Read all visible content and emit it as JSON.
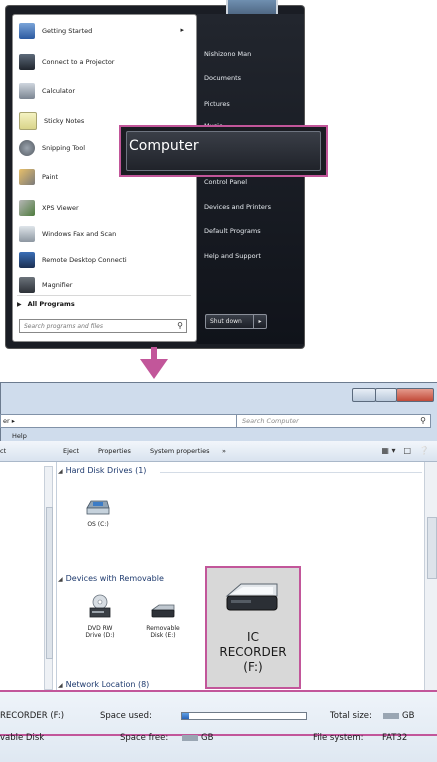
{
  "start_menu": {
    "programs": [
      {
        "label": "Getting Started",
        "icon": "getting-started-icon",
        "has_submenu": true
      },
      {
        "label": "Connect to a Projector",
        "icon": "projector-icon"
      },
      {
        "label": "Calculator",
        "icon": "calculator-icon"
      },
      {
        "label": "Sticky Notes",
        "icon": "sticky-notes-icon"
      },
      {
        "label": "Snipping Tool",
        "icon": "scissors-icon"
      },
      {
        "label": "Paint",
        "icon": "paint-icon"
      },
      {
        "label": "XPS Viewer",
        "icon": "xps-icon"
      },
      {
        "label": "Windows Fax and Scan",
        "icon": "fax-icon"
      },
      {
        "label": "Remote Desktop Connecti",
        "icon": "remote-desktop-icon"
      },
      {
        "label": "Magnifier",
        "icon": "magnifier-icon"
      }
    ],
    "all_programs": "All Programs",
    "search_placeholder": "Search programs and files",
    "right_links": [
      "Nishizono Man",
      "Documents",
      "Pictures",
      "Music",
      "Control Panel",
      "Devices and Printers",
      "Default Programs",
      "Help and Support"
    ],
    "computer_label": "Computer",
    "shutdown_label": "Shut down"
  },
  "explorer": {
    "address": "er ▸",
    "search_placeholder": "Search Computer",
    "menu_help": "Help",
    "toolbar": [
      "ect",
      "Eject",
      "Properties",
      "System properties",
      "»"
    ],
    "groups": {
      "hard_disks": "Hard Disk Drives (1)",
      "removable": "Devices with Removable",
      "network": "Network Location (8)"
    },
    "drives": {
      "os": "OS (C:)",
      "dvd": [
        "DVD RW",
        "Drive (D:)"
      ],
      "removable": [
        "Removable",
        "Disk (E:)"
      ],
      "ic_recorder": [
        "IC",
        "RECORDER",
        "(F:)"
      ]
    }
  },
  "details": {
    "name": "RECORDER (F:)",
    "type": "vable Disk",
    "space_used_label": "Space used:",
    "space_free_label": "Space free:",
    "space_free_value": "GB",
    "total_size_label": "Total size:",
    "total_size_value": "GB",
    "file_system_label": "File system:",
    "file_system_value": "FAT32",
    "used_fraction": 0.06
  },
  "colors": {
    "highlight": "#c2569a",
    "start_menu_dark": "#1a1d24"
  }
}
